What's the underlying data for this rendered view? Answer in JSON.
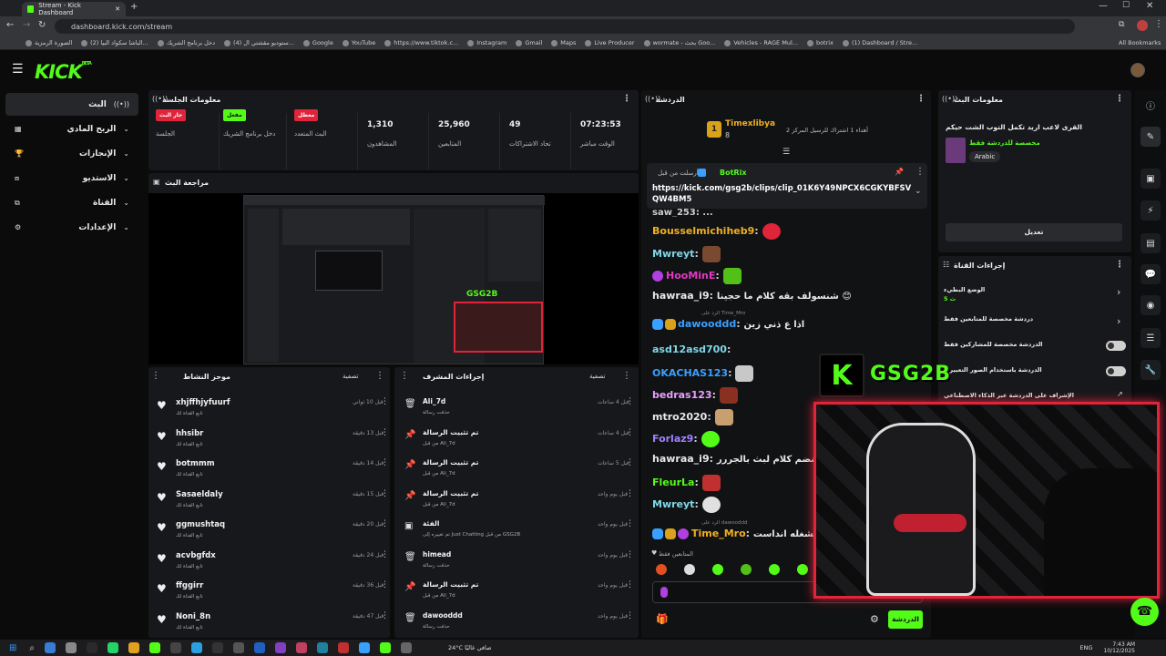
{
  "browser": {
    "tab_title": "Stream - Kick Dashboard",
    "url": "dashboard.kick.com/stream",
    "bookmarks": [
      "الصورة الرمزية",
      "(2) الباشا سكواد البيا...",
      "دخل برنامج الشريك",
      "(4) ستوديو مقشتي ال...",
      "Google",
      "YouTube",
      "https://www.tiktok.c...",
      "Instagram",
      "Gmail",
      "Maps",
      "Live Producer",
      "wormate - بحث Goo...",
      "Vehicles - RAGE Mul...",
      "botrix",
      "(1) Dashboard / Stre..."
    ],
    "all_bookmarks": "All Bookmarks"
  },
  "brand": {
    "logo": "KICK",
    "beta": "BETA"
  },
  "nav": {
    "items": [
      {
        "label": "البث",
        "icon": "live"
      },
      {
        "label": "الربح المادي",
        "icon": "money"
      },
      {
        "label": "الإنجازات",
        "icon": "trophy"
      },
      {
        "label": "الاستديو",
        "icon": "studio"
      },
      {
        "label": "القناة",
        "icon": "channel"
      },
      {
        "label": "الإعدادات",
        "icon": "gear"
      }
    ]
  },
  "session": {
    "title": "معلومات الجلسة",
    "stats": [
      {
        "badge": "جار البث",
        "label": "الجلسة",
        "color": "#e0243a"
      },
      {
        "badge": "مفعل",
        "label": "دخل برنامج الشريك",
        "color": "#53fc18"
      },
      {
        "badge": "معطل",
        "label": "البث المتعدد",
        "color": "#e0243a"
      },
      {
        "value": "1,310",
        "label": "المشاهدون"
      },
      {
        "value": "25,960",
        "label": "المتابعين"
      },
      {
        "value": "49",
        "label": "تحاد الاشتراكات"
      },
      {
        "value": "07:23:53",
        "label": "الوقت مباشر"
      }
    ]
  },
  "preview": {
    "title": "مراجعة البث",
    "overlay_name": "GSG2B"
  },
  "activity": {
    "title": "موجز النشاط",
    "filter": "تصفية",
    "items": [
      {
        "name": "xhjffhjyfuurf",
        "sub": "تابع القناة لك",
        "time": "قبل 10 ثواني"
      },
      {
        "name": "hhsibr",
        "sub": "تابع القناة لك",
        "time": "قبل 13 دقيقة"
      },
      {
        "name": "botmmm",
        "sub": "تابع القناة لك",
        "time": "قبل 14 دقيقة"
      },
      {
        "name": "Sasaeldaly",
        "sub": "تابع القناة لك",
        "time": "قبل 15 دقيقة"
      },
      {
        "name": "ggmushtaq",
        "sub": "تابع القناة لك",
        "time": "قبل 20 دقيقة"
      },
      {
        "name": "acvbgfdx",
        "sub": "تابع القناة لك",
        "time": "قبل 24 دقيقة"
      },
      {
        "name": "ffggirr",
        "sub": "تابع القناة لك",
        "time": "قبل 36 دقيقة"
      },
      {
        "name": "Noni_8n",
        "sub": "تابع القناة لك",
        "time": "قبل 47 دقيقة"
      }
    ]
  },
  "modactions": {
    "title": "إجراءات المشرف",
    "filter": "تصفية",
    "items": [
      {
        "name": "Ali_7d",
        "sub": "حذفت رسالة",
        "time": "قبل 4 ساعات",
        "icon": "trash"
      },
      {
        "name": "تم تثبيت الرسالة",
        "sub": "من قبل Ali_7d",
        "time": "قبل 4 ساعات",
        "icon": "pin"
      },
      {
        "name": "تم تثبيت الرسالة",
        "sub": "من قبل Ali_7d",
        "time": "قبل 5 ساعات",
        "icon": "pin"
      },
      {
        "name": "تم تثبيت الرسالة",
        "sub": "من قبل Ali_7d",
        "time": "قبل يوم واحد",
        "icon": "pin"
      },
      {
        "name": "الفئة",
        "sub": "تم تغييره إلى Just Chatting من قبل GSG2B",
        "time": "قبل يوم واحد",
        "icon": "category"
      },
      {
        "name": "himead",
        "sub": "حذفت رسالة",
        "time": "قبل يوم واحد",
        "icon": "trash"
      },
      {
        "name": "تم تثبيت الرسالة",
        "sub": "من قبل Ali_7d",
        "time": "قبل يوم واحد",
        "icon": "pin"
      },
      {
        "name": "dawooddd",
        "sub": "حذفت رسالة",
        "time": "قبل يوم واحد",
        "icon": "trash"
      }
    ]
  },
  "chat": {
    "title": "الدردشة",
    "top_gifter": {
      "name": "Timexlibya",
      "count": "8",
      "rank": "1",
      "note": "أهداء 1 اشتراك للرسيل المركز 2"
    },
    "pinned": {
      "author": "BotRix",
      "prefix": "أرسلت من قبل",
      "link": "https://kick.com/gsg2b/clips/clip_01K6Y49NPCX6CGKYBFSVQW4BM5"
    },
    "partial_top": "saw_253: ...",
    "messages": [
      {
        "user": "Bousselmichiheb9",
        "text": "",
        "color": "#f0b020",
        "emote": "heart"
      },
      {
        "user": "Mwreyt",
        "text": "",
        "color": "#7fd7e8",
        "emote": "face"
      },
      {
        "user": "HooMinE",
        "text": "",
        "color": "#e03ac0",
        "emote": "frog"
      },
      {
        "user": "hawraa_i9",
        "text": "شنسولف بقه كلام ما حجينا 😊",
        "color": "#e8e8e8",
        "emote": ""
      },
      {
        "user": "dawooddd",
        "text": "اذا ع ذني زين",
        "color": "#3aa0ff",
        "emote": "",
        "reply": "الرد على Time_Mro"
      },
      {
        "user": "asd12asd700",
        "text": "",
        "color": "#7fd7e8",
        "emote": ""
      },
      {
        "user": "OKACHAS123",
        "text": "",
        "color": "#3aa0ff",
        "emote": "cat"
      },
      {
        "user": "bedras123",
        "text": "",
        "color": "#e8a0ff",
        "emote": "bottle"
      },
      {
        "user": "mtro2020",
        "text": "",
        "color": "#e8e8e8",
        "emote": "hand"
      },
      {
        "user": "Forlaz9",
        "text": "",
        "color": "#a080ff",
        "emote": "blob"
      },
      {
        "user": "hawraa_i9",
        "text": "خلي نضم كلام لبث بالجررر",
        "color": "#e8e8e8",
        "emote": ""
      },
      {
        "user": "FleurLa",
        "text": "",
        "color": "#53fc18",
        "emote": "red"
      },
      {
        "user": "Mwreyt",
        "text": "",
        "color": "#7fd7e8",
        "emote": "skull"
      },
      {
        "user": "Time_Mro",
        "text": "ر الشغله انداست",
        "color": "#f0b020",
        "emote": "",
        "reply": "الرد على dawooddd"
      }
    ],
    "followers_only": "المتابعين فقط",
    "send_label": "الدردشة"
  },
  "stream_info": {
    "title": "معلومات البث",
    "stream_title": "القرى لاعب اريد تكمل التوب الشت حيكم ❤️ |",
    "category": "مخصصة للدردشة فقط",
    "language": "Arabic",
    "edit_label": "تعديل"
  },
  "channel_actions": {
    "title": "إجراءات القناة",
    "items": [
      {
        "label": "الوضع البطيء",
        "sub": "5 ث",
        "control": "chevron"
      },
      {
        "label": "دردشة مخصصة للمتابعين فقط",
        "control": "chevron"
      },
      {
        "label": "الدردشة مخصصة للمشاركين فقط",
        "control": "toggle"
      },
      {
        "label": "الدردشة باستخدام الصور التعبيرية",
        "control": "toggle"
      },
      {
        "label": "الإشراف على الدردشة عبر الذكاء الاصطناعي",
        "control": "link"
      }
    ]
  },
  "overlay": {
    "name": "GSG2B"
  },
  "taskbar": {
    "weather": "24°C صافي غالبًا",
    "lang": "ENG",
    "time": "7:43 AM",
    "date": "10/12/2025"
  },
  "colors": {
    "accent": "#53fc18",
    "live": "#e0243a",
    "panel": "#17181b"
  }
}
